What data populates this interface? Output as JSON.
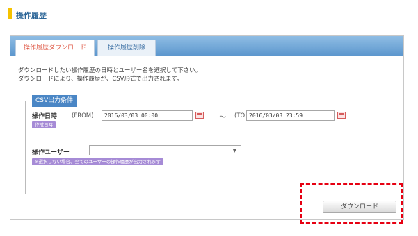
{
  "header": {
    "title": "操作履歴"
  },
  "tabs": [
    {
      "label": "操作履歴ダウンロード",
      "active": true
    },
    {
      "label": "操作履歴削除",
      "active": false
    }
  ],
  "description": [
    "ダウンロードしたい操作履歴の日時とユーザー名を選択して下さい。",
    "ダウンロードにより、操作履歴が、CSV形式で出力されます。"
  ],
  "csv_conditions": {
    "legend": "CSV出力条件",
    "date": {
      "label": "操作日時",
      "required_badge": "作成日時",
      "from_label": "(FROM)",
      "from_value": "2016/03/03 00:00",
      "tilde": "～",
      "to_label": "(TO)",
      "to_value": "2016/03/03 23:59"
    },
    "user": {
      "label": "操作ユーザー",
      "selected_value": "",
      "note": "※選択しない場合、全てのユーザーの操作履歴が出力されます"
    }
  },
  "actions": {
    "download_label": "ダウンロード"
  },
  "colors": {
    "accent_yellow": "#f5c200",
    "tab_blue": "#5b96cd",
    "legend_blue": "#4a86c5",
    "badge_purple": "#a68bd6",
    "highlight_red": "#e60012"
  },
  "icons": {
    "calendar": "calendar-icon",
    "dropdown": "chevron-down-icon"
  }
}
